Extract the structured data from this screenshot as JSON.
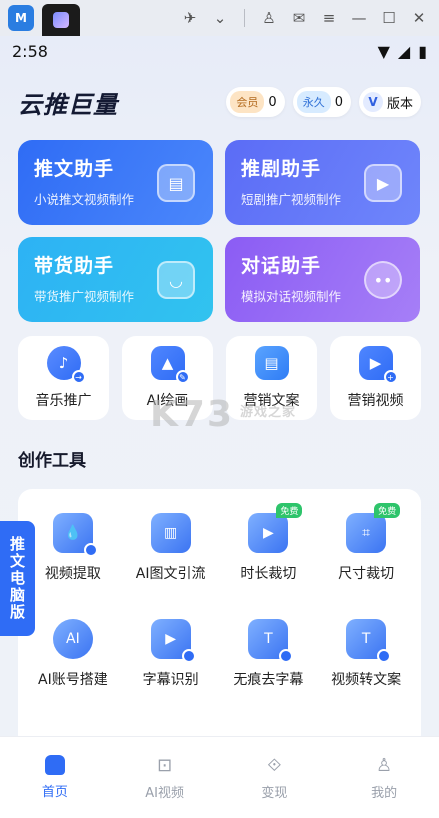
{
  "window": {
    "app_badge": "M",
    "icons": [
      "pin-icon",
      "chevron-down-icon",
      "user-icon",
      "mail-icon",
      "menu-icon",
      "minimize-icon",
      "maximize-icon",
      "close-icon"
    ]
  },
  "status_bar": {
    "time": "2:58"
  },
  "header": {
    "title": "云推巨量",
    "vip_tag": "会员",
    "vip_count": "0",
    "perm_tag": "永久",
    "perm_count": "0",
    "version_tag": "V",
    "version_label": "版本"
  },
  "feature_cards": [
    {
      "title": "推文助手",
      "subtitle": "小说推文视频制作"
    },
    {
      "title": "推剧助手",
      "subtitle": "短剧推广视频制作"
    },
    {
      "title": "带货助手",
      "subtitle": "带货推广视频制作"
    },
    {
      "title": "对话助手",
      "subtitle": "模拟对话视频制作"
    }
  ],
  "quick_actions": [
    {
      "label": "音乐推广"
    },
    {
      "label": "AI绘画"
    },
    {
      "label": "营销文案"
    },
    {
      "label": "营销视频"
    }
  ],
  "section_title": "创作工具",
  "tools": [
    {
      "label": "视频提取",
      "badge": ""
    },
    {
      "label": "AI图文引流",
      "badge": ""
    },
    {
      "label": "时长裁切",
      "badge": "免费"
    },
    {
      "label": "尺寸裁切",
      "badge": "免费"
    },
    {
      "label": "AI账号搭建",
      "badge": ""
    },
    {
      "label": "字幕识别",
      "badge": ""
    },
    {
      "label": "无痕去字幕",
      "badge": ""
    },
    {
      "label": "视频转文案",
      "badge": ""
    }
  ],
  "side_tab": "推文电脑版",
  "watermark": {
    "main": "K73",
    "sub": "游戏之家"
  },
  "bottom_nav": [
    {
      "label": "首页",
      "active": true
    },
    {
      "label": "AI视频",
      "active": false
    },
    {
      "label": "变现",
      "active": false
    },
    {
      "label": "我的",
      "active": false
    }
  ],
  "colors": {
    "accent": "#2f6cf5",
    "free_badge": "#2ec46b"
  }
}
